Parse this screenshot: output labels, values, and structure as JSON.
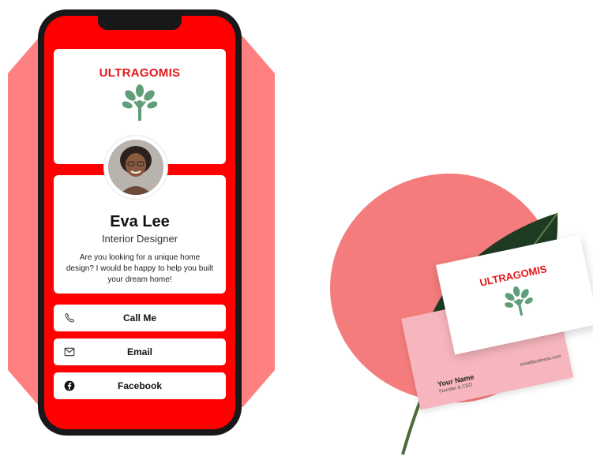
{
  "profile": {
    "brand": "ULTRAGOMIS",
    "name": "Eva Lee",
    "title": "Interior Designer",
    "bio": "Are you looking for a unique home design? I would be happy to help you built your dream home!"
  },
  "buttons": [
    {
      "label": "Call Me",
      "icon": "phone-icon"
    },
    {
      "label": "Email",
      "icon": "email-icon"
    },
    {
      "label": "Facebook",
      "icon": "facebook-icon"
    }
  ],
  "business_card": {
    "brand": "ULTRAGOMIS",
    "your_name": "Your Name",
    "role": "Founder & CEO",
    "website": "emailtbusiness.com"
  },
  "colors": {
    "brand_red": "#e3161b",
    "screen_red": "#ff0000",
    "backdrop_pink": "#ff8080",
    "tree_green": "#5f9e78",
    "card_pink": "#f7b6bd"
  }
}
